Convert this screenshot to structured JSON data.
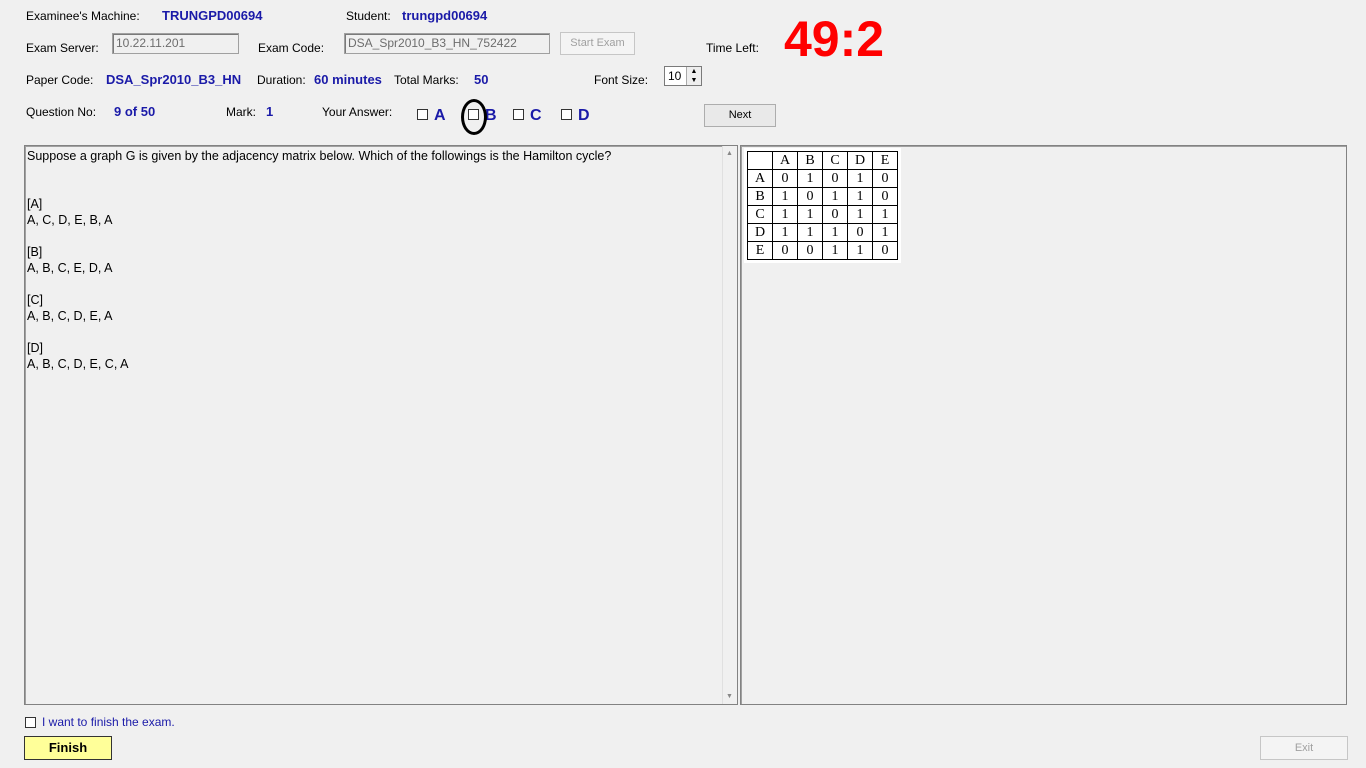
{
  "header": {
    "machine_label": "Examinee's Machine:",
    "machine_value": "TRUNGPD00694",
    "student_label": "Student:",
    "student_value": "trungpd00694",
    "server_label": "Exam Server:",
    "server_value": "10.22.11.201",
    "exam_code_label": "Exam Code:",
    "exam_code_value": "DSA_Spr2010_B3_HN_752422",
    "start_exam_label": "Start Exam",
    "time_left_label": "Time Left:",
    "time_left_value": "49:2",
    "paper_code_label": "Paper Code:",
    "paper_code_value": "DSA_Spr2010_B3_HN",
    "duration_label": "Duration:",
    "duration_value": "60 minutes",
    "total_marks_label": "Total Marks:",
    "total_marks_value": "50",
    "font_size_label": "Font Size:",
    "font_size_value": "10",
    "question_no_label": "Question No:",
    "question_no_value": "9 of 50",
    "mark_label": "Mark:",
    "mark_value": "1",
    "your_answer_label": "Your Answer:",
    "options": [
      "A",
      "B",
      "C",
      "D"
    ],
    "next_label": "Next"
  },
  "question": {
    "text": "Suppose a graph G is given by the adjacency matrix below. Which of the followings is the Hamilton cycle?",
    "answers": [
      {
        "tag": "[A]",
        "text": "A, C, D, E, B, A"
      },
      {
        "tag": "[B]",
        "text": "A, B, C, E, D, A"
      },
      {
        "tag": "[C]",
        "text": "A, B, C, D, E, A"
      },
      {
        "tag": "[D]",
        "text": "A, B, C, D, E, C, A"
      }
    ]
  },
  "matrix": {
    "headers": [
      "A",
      "B",
      "C",
      "D",
      "E"
    ],
    "rows": [
      {
        "label": "A",
        "cells": [
          "0",
          "1",
          "0",
          "1",
          "0"
        ]
      },
      {
        "label": "B",
        "cells": [
          "1",
          "0",
          "1",
          "1",
          "0"
        ]
      },
      {
        "label": "C",
        "cells": [
          "1",
          "1",
          "0",
          "1",
          "1"
        ]
      },
      {
        "label": "D",
        "cells": [
          "1",
          "1",
          "1",
          "0",
          "1"
        ]
      },
      {
        "label": "E",
        "cells": [
          "0",
          "0",
          "1",
          "1",
          "0"
        ]
      }
    ]
  },
  "footer": {
    "finish_checkbox_label": "I want to finish the exam.",
    "finish_label": "Finish",
    "exit_label": "Exit"
  },
  "colors": {
    "accent_blue": "#1a1aa8",
    "timer_red": "#ff0000",
    "finish_yellow": "#ffff99"
  }
}
